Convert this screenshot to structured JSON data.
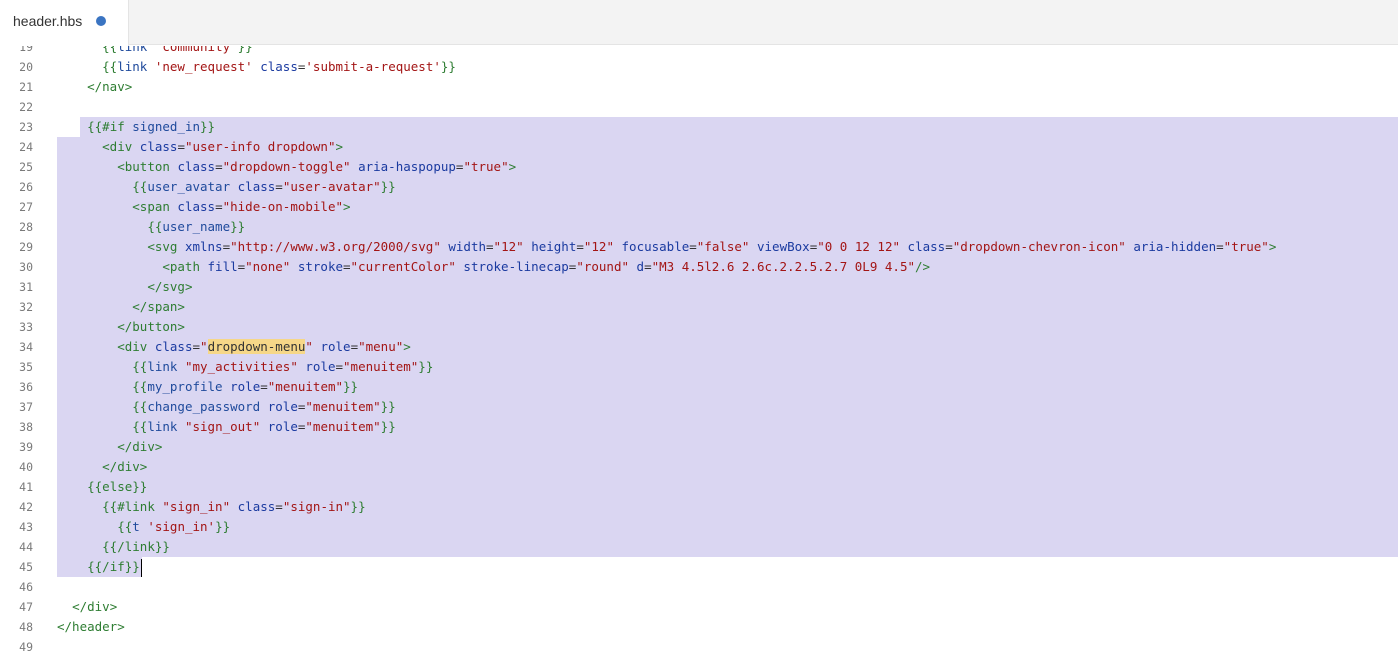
{
  "tab": {
    "filename": "header.hbs"
  },
  "lines": [
    {
      "n": "19",
      "indent": "      ",
      "tokens": [
        [
          "p",
          "{{"
        ],
        [
          "hv",
          "link "
        ],
        [
          "st",
          "'community'"
        ],
        [
          "p",
          "}}"
        ]
      ]
    },
    {
      "n": "20",
      "indent": "      ",
      "tokens": [
        [
          "p",
          "{{"
        ],
        [
          "hv",
          "link "
        ],
        [
          "st",
          "'new_request'"
        ],
        [
          "pl",
          " "
        ],
        [
          "at",
          "class"
        ],
        [
          "pl",
          "="
        ],
        [
          "st",
          "'submit-a-request'"
        ],
        [
          "p",
          "}}"
        ]
      ]
    },
    {
      "n": "21",
      "indent": "    ",
      "tokens": [
        [
          "tg",
          "</nav>"
        ]
      ]
    },
    {
      "n": "22",
      "indent": "",
      "tokens": []
    },
    {
      "n": "23",
      "indent": "    ",
      "tokens": [
        [
          "p",
          "{{"
        ],
        [
          "kw",
          "#if "
        ],
        [
          "hv",
          "signed_in"
        ],
        [
          "p",
          "}}"
        ]
      ]
    },
    {
      "n": "24",
      "indent": "      ",
      "tokens": [
        [
          "tg",
          "<div "
        ],
        [
          "at",
          "class"
        ],
        [
          "pl",
          "="
        ],
        [
          "st",
          "\"user-info dropdown\""
        ],
        [
          "tg",
          ">"
        ]
      ]
    },
    {
      "n": "25",
      "indent": "        ",
      "tokens": [
        [
          "tg",
          "<button "
        ],
        [
          "at",
          "class"
        ],
        [
          "pl",
          "="
        ],
        [
          "st",
          "\"dropdown-toggle\""
        ],
        [
          "pl",
          " "
        ],
        [
          "at",
          "aria-haspopup"
        ],
        [
          "pl",
          "="
        ],
        [
          "st",
          "\"true\""
        ],
        [
          "tg",
          ">"
        ]
      ]
    },
    {
      "n": "26",
      "indent": "          ",
      "tokens": [
        [
          "p",
          "{{"
        ],
        [
          "hv",
          "user_avatar "
        ],
        [
          "at",
          "class"
        ],
        [
          "pl",
          "="
        ],
        [
          "st",
          "\"user-avatar\""
        ],
        [
          "p",
          "}}"
        ]
      ]
    },
    {
      "n": "27",
      "indent": "          ",
      "tokens": [
        [
          "tg",
          "<span "
        ],
        [
          "at",
          "class"
        ],
        [
          "pl",
          "="
        ],
        [
          "st",
          "\"hide-on-mobile\""
        ],
        [
          "tg",
          ">"
        ]
      ]
    },
    {
      "n": "28",
      "indent": "            ",
      "tokens": [
        [
          "p",
          "{{"
        ],
        [
          "hv",
          "user_name"
        ],
        [
          "p",
          "}}"
        ]
      ]
    },
    {
      "n": "29",
      "indent": "            ",
      "tokens": [
        [
          "tg",
          "<svg "
        ],
        [
          "at",
          "xmlns"
        ],
        [
          "pl",
          "="
        ],
        [
          "st",
          "\"http://www.w3.org/2000/svg\""
        ],
        [
          "pl",
          " "
        ],
        [
          "at",
          "width"
        ],
        [
          "pl",
          "="
        ],
        [
          "st",
          "\"12\""
        ],
        [
          "pl",
          " "
        ],
        [
          "at",
          "height"
        ],
        [
          "pl",
          "="
        ],
        [
          "st",
          "\"12\""
        ],
        [
          "pl",
          " "
        ],
        [
          "at",
          "focusable"
        ],
        [
          "pl",
          "="
        ],
        [
          "st",
          "\"false\""
        ],
        [
          "pl",
          " "
        ],
        [
          "at",
          "viewBox"
        ],
        [
          "pl",
          "="
        ],
        [
          "st",
          "\"0 0 12 12\""
        ],
        [
          "pl",
          " "
        ],
        [
          "at",
          "class"
        ],
        [
          "pl",
          "="
        ],
        [
          "st",
          "\"dropdown-chevron-icon\""
        ],
        [
          "pl",
          " "
        ],
        [
          "at",
          "aria-hidden"
        ],
        [
          "pl",
          "="
        ],
        [
          "st",
          "\"true\""
        ],
        [
          "tg",
          ">"
        ]
      ]
    },
    {
      "n": "30",
      "indent": "              ",
      "tokens": [
        [
          "tg",
          "<path "
        ],
        [
          "at",
          "fill"
        ],
        [
          "pl",
          "="
        ],
        [
          "st",
          "\"none\""
        ],
        [
          "pl",
          " "
        ],
        [
          "at",
          "stroke"
        ],
        [
          "pl",
          "="
        ],
        [
          "st",
          "\"currentColor\""
        ],
        [
          "pl",
          " "
        ],
        [
          "at",
          "stroke-linecap"
        ],
        [
          "pl",
          "="
        ],
        [
          "st",
          "\"round\""
        ],
        [
          "pl",
          " "
        ],
        [
          "at",
          "d"
        ],
        [
          "pl",
          "="
        ],
        [
          "st",
          "\"M3 4.5l2.6 2.6c.2.2.5.2.7 0L9 4.5\""
        ],
        [
          "tg",
          "/>"
        ]
      ]
    },
    {
      "n": "31",
      "indent": "            ",
      "tokens": [
        [
          "tg",
          "</svg>"
        ]
      ]
    },
    {
      "n": "32",
      "indent": "          ",
      "tokens": [
        [
          "tg",
          "</span>"
        ]
      ]
    },
    {
      "n": "33",
      "indent": "        ",
      "tokens": [
        [
          "tg",
          "</button>"
        ]
      ]
    },
    {
      "n": "34",
      "indent": "        ",
      "tokens": [
        [
          "tg",
          "<div "
        ],
        [
          "at",
          "class"
        ],
        [
          "pl",
          "="
        ],
        [
          "st",
          "\""
        ],
        [
          "hl",
          "dropdown-menu"
        ],
        [
          "st",
          "\""
        ],
        [
          "pl",
          " "
        ],
        [
          "at",
          "role"
        ],
        [
          "pl",
          "="
        ],
        [
          "st",
          "\"menu\""
        ],
        [
          "tg",
          ">"
        ]
      ]
    },
    {
      "n": "35",
      "indent": "          ",
      "tokens": [
        [
          "p",
          "{{"
        ],
        [
          "hv",
          "link "
        ],
        [
          "st",
          "\"my_activities\""
        ],
        [
          "pl",
          " "
        ],
        [
          "at",
          "role"
        ],
        [
          "pl",
          "="
        ],
        [
          "st",
          "\"menuitem\""
        ],
        [
          "p",
          "}}"
        ]
      ]
    },
    {
      "n": "36",
      "indent": "          ",
      "tokens": [
        [
          "p",
          "{{"
        ],
        [
          "hv",
          "my_profile "
        ],
        [
          "at",
          "role"
        ],
        [
          "pl",
          "="
        ],
        [
          "st",
          "\"menuitem\""
        ],
        [
          "p",
          "}}"
        ]
      ]
    },
    {
      "n": "37",
      "indent": "          ",
      "tokens": [
        [
          "p",
          "{{"
        ],
        [
          "hv",
          "change_password "
        ],
        [
          "at",
          "role"
        ],
        [
          "pl",
          "="
        ],
        [
          "st",
          "\"menuitem\""
        ],
        [
          "p",
          "}}"
        ]
      ]
    },
    {
      "n": "38",
      "indent": "          ",
      "tokens": [
        [
          "p",
          "{{"
        ],
        [
          "hv",
          "link "
        ],
        [
          "st",
          "\"sign_out\""
        ],
        [
          "pl",
          " "
        ],
        [
          "at",
          "role"
        ],
        [
          "pl",
          "="
        ],
        [
          "st",
          "\"menuitem\""
        ],
        [
          "p",
          "}}"
        ]
      ]
    },
    {
      "n": "39",
      "indent": "        ",
      "tokens": [
        [
          "tg",
          "</div>"
        ]
      ]
    },
    {
      "n": "40",
      "indent": "      ",
      "tokens": [
        [
          "tg",
          "</div>"
        ]
      ]
    },
    {
      "n": "41",
      "indent": "    ",
      "tokens": [
        [
          "p",
          "{{"
        ],
        [
          "kw",
          "else"
        ],
        [
          "p",
          "}}"
        ]
      ]
    },
    {
      "n": "42",
      "indent": "      ",
      "tokens": [
        [
          "p",
          "{{"
        ],
        [
          "kw",
          "#link "
        ],
        [
          "st",
          "\"sign_in\""
        ],
        [
          "pl",
          " "
        ],
        [
          "at",
          "class"
        ],
        [
          "pl",
          "="
        ],
        [
          "st",
          "\"sign-in\""
        ],
        [
          "p",
          "}}"
        ]
      ]
    },
    {
      "n": "43",
      "indent": "        ",
      "tokens": [
        [
          "p",
          "{{"
        ],
        [
          "hv",
          "t "
        ],
        [
          "st",
          "'sign_in'"
        ],
        [
          "p",
          "}}"
        ]
      ]
    },
    {
      "n": "44",
      "indent": "      ",
      "tokens": [
        [
          "p",
          "{{"
        ],
        [
          "kw",
          "/link"
        ],
        [
          "p",
          "}}"
        ]
      ]
    },
    {
      "n": "45",
      "indent": "    ",
      "tokens": [
        [
          "p",
          "{{"
        ],
        [
          "kw",
          "/if"
        ],
        [
          "p",
          "}}"
        ]
      ]
    },
    {
      "n": "46",
      "indent": "",
      "tokens": []
    },
    {
      "n": "47",
      "indent": "  ",
      "tokens": [
        [
          "tg",
          "</div>"
        ]
      ]
    },
    {
      "n": "48",
      "indent": "",
      "tokens": [
        [
          "tg",
          "</header>"
        ]
      ]
    },
    {
      "n": "49",
      "indent": "",
      "tokens": []
    }
  ],
  "selection": {
    "start_line": "23",
    "end_line": "45",
    "cursor_line": "45"
  }
}
